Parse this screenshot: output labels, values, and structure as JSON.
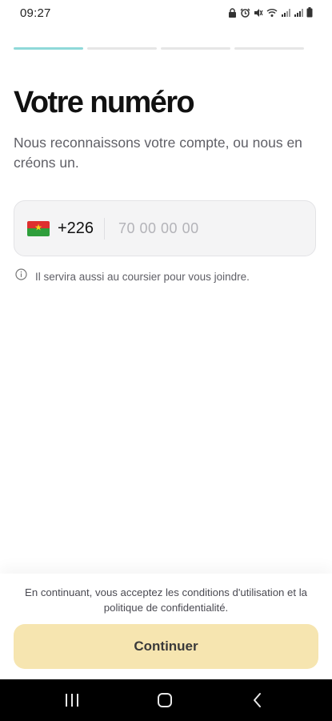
{
  "status_bar": {
    "time": "09:27",
    "icons": [
      "lock-icon",
      "alarm-icon",
      "mute-icon",
      "wifi-icon",
      "signal-icon",
      "signal-icon",
      "battery-icon"
    ]
  },
  "progress": {
    "total_steps": 4,
    "current_step": 1,
    "active_color": "#8fd9d9"
  },
  "page": {
    "title": "Votre numéro",
    "subtitle": "Nous reconnaissons votre compte, ou nous en créons un."
  },
  "phone": {
    "country_flag": "flag-burkina-faso",
    "dial_code": "+226",
    "value": "",
    "placeholder": "70 00 00 00"
  },
  "helper": {
    "icon": "info-icon",
    "text": "Il servira aussi au coursier pour vous joindre."
  },
  "footer": {
    "terms": "En continuant, vous acceptez les conditions d'utilisation et la politique de confidentialité.",
    "continue_label": "Continuer",
    "button_color": "#f6e5b0"
  },
  "nav_bar": {
    "buttons": [
      "recent-apps-icon",
      "home-icon",
      "back-icon"
    ]
  }
}
